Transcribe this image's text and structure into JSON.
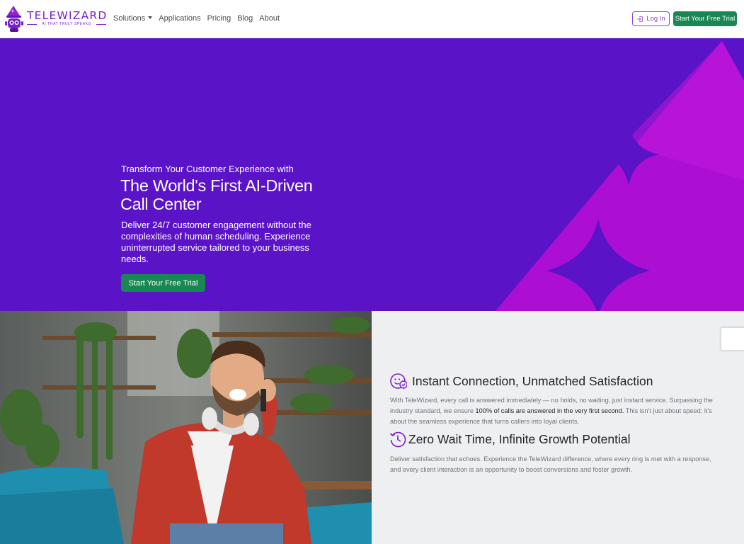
{
  "brand": {
    "name": "TELEWIZARD",
    "tagline": "AI THAT TRULY SPEAKS",
    "logo_icon": "wizard-robot-logo",
    "color": "#7b1fd0"
  },
  "nav": {
    "items": [
      {
        "label": "Solutions",
        "has_dropdown": true
      },
      {
        "label": "Applications"
      },
      {
        "label": "Pricing"
      },
      {
        "label": "Blog"
      },
      {
        "label": "About"
      }
    ],
    "login_label": "Log In",
    "login_icon": "login-icon",
    "trial_label": "Start Your Free Trial"
  },
  "hero": {
    "pretitle": "Transform Your Customer Experience with",
    "title": "The World's First AI-Driven Call Center",
    "description": "Deliver 24/7 customer engagement without the complexities of human scheduling. Experience uninterrupted service tailored to your business needs.",
    "cta_label": "Start Your Free Trial",
    "background_color": "#5b13c7",
    "accent_color": "#b80fd6"
  },
  "features": [
    {
      "icon": "smile-check-icon",
      "title": "Instant Connection, Unmatched Satisfaction",
      "body_before": "With TeleWizard, every call is answered immediately — no holds, no waiting, just instant service. Surpassing the industry standard, we ensure ",
      "body_bold": "100% of calls are answered in the very first second.",
      "body_after": " This isn't just about speed; it's about the seamless experience that turns callers into loyal clients."
    },
    {
      "icon": "clock-history-icon",
      "title": "Zero Wait Time, Infinite Growth Potential",
      "body": "Deliver satisfaction that echoes. Experience the TeleWizard difference, where every ring is met with a response, and every client interaction is an opportunity to boost conversions and foster growth."
    }
  ],
  "colors": {
    "cta_green": "#198754",
    "feature_bg": "#eeeff1"
  }
}
